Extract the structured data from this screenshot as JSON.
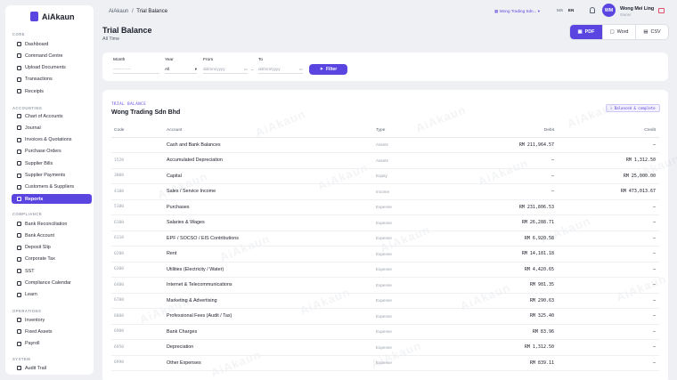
{
  "brand": {
    "name": "AiAkaun"
  },
  "sidebar": {
    "sections": [
      {
        "title": "CORE",
        "items": [
          {
            "label": "Dashboard",
            "icon": "dashboard-icon"
          },
          {
            "label": "Command Centre",
            "icon": "grid-icon"
          },
          {
            "label": "Upload Documents",
            "icon": "upload-icon"
          },
          {
            "label": "Transactions",
            "icon": "transactions-icon"
          },
          {
            "label": "Receipts",
            "icon": "receipt-icon"
          }
        ]
      },
      {
        "title": "ACCOUNTING",
        "items": [
          {
            "label": "Chart of Accounts",
            "icon": "chart-icon"
          },
          {
            "label": "Journal",
            "icon": "journal-icon"
          },
          {
            "label": "Invoices & Quotations",
            "icon": "invoice-icon"
          },
          {
            "label": "Purchase Orders",
            "icon": "cart-icon"
          },
          {
            "label": "Supplier Bills",
            "icon": "bill-icon"
          },
          {
            "label": "Supplier Payments",
            "icon": "payment-icon"
          },
          {
            "label": "Customers & Suppliers",
            "icon": "users-icon"
          },
          {
            "label": "Reports",
            "icon": "report-icon",
            "active": true
          }
        ]
      },
      {
        "title": "COMPLIANCE",
        "items": [
          {
            "label": "Bank Reconciliation",
            "icon": "check-icon"
          },
          {
            "label": "Bank Account",
            "icon": "bank-icon"
          },
          {
            "label": "Deposit Slip",
            "icon": "deposit-icon"
          },
          {
            "label": "Corporate Tax",
            "icon": "tax-icon"
          },
          {
            "label": "SST",
            "icon": "sst-icon"
          },
          {
            "label": "Compliance Calendar",
            "icon": "calendar-icon"
          },
          {
            "label": "Learn",
            "icon": "learn-icon"
          }
        ]
      },
      {
        "title": "OPERATIONS",
        "items": [
          {
            "label": "Inventory",
            "icon": "box-icon"
          },
          {
            "label": "Fixed Assets",
            "icon": "asset-icon"
          },
          {
            "label": "Payroll",
            "icon": "payroll-icon"
          }
        ]
      },
      {
        "title": "SYSTEM",
        "items": [
          {
            "label": "Audit Trail",
            "icon": "audit-icon"
          }
        ]
      }
    ]
  },
  "topbar": {
    "breadcrumb_root": "AiAkaun",
    "breadcrumb_sep": "/",
    "breadcrumb_current": "Trial Balance",
    "company_select": "Wong Trading Sdn...",
    "lang_ms": "MS",
    "lang_en": "EN",
    "avatar_initials": "WM",
    "user_name": "Wong Mei Ling",
    "user_role": "Owner"
  },
  "page": {
    "title": "Trial Balance",
    "subtitle": "All Time"
  },
  "export": {
    "pdf": "PDF",
    "word": "Word",
    "csv": "CSV"
  },
  "filters": {
    "month_label": "Month",
    "month_placeholder": "-------- ----",
    "year_label": "Year",
    "year_value": "All",
    "from_label": "From",
    "from_placeholder": "dd/mm/yyyy",
    "to_label": "To",
    "to_placeholder": "dd/mm/yyyy",
    "dash": "–",
    "filter_button": "Filter"
  },
  "report": {
    "eyebrow": "TRIAL BALANCE",
    "company": "Wong Trading Sdn Bhd",
    "badge": "✓ Balanced & complete",
    "watermark": "AiAkaun",
    "columns": {
      "code": "Code",
      "account": "Account",
      "type": "Type",
      "debit": "Debit",
      "credit": "Credit"
    },
    "rows": [
      {
        "code": "",
        "account": "Cash and Bank Balances",
        "type": "Assets",
        "debit": "RM 211,964.57",
        "credit": "—"
      },
      {
        "code": "1520",
        "account": "Accumulated Depreciation",
        "type": "Assets",
        "debit": "—",
        "credit": "RM 1,312.50"
      },
      {
        "code": "3000",
        "account": "Capital",
        "type": "Equity",
        "debit": "—",
        "credit": "RM 25,000.00"
      },
      {
        "code": "4100",
        "account": "Sales / Service Income",
        "type": "Income",
        "debit": "—",
        "credit": "RM 473,013.67"
      },
      {
        "code": "5100",
        "account": "Purchases",
        "type": "Expense",
        "debit": "RM 231,806.53",
        "credit": "—"
      },
      {
        "code": "6100",
        "account": "Salaries & Wages",
        "type": "Expense",
        "debit": "RM 26,288.71",
        "credit": "—"
      },
      {
        "code": "6110",
        "account": "EPF / SOCSO / EIS Contributions",
        "type": "Expense",
        "debit": "RM 6,920.58",
        "credit": "—"
      },
      {
        "code": "6200",
        "account": "Rent",
        "type": "Expense",
        "debit": "RM 14,181.18",
        "credit": "—"
      },
      {
        "code": "6300",
        "account": "Utilities (Electricity / Water)",
        "type": "Expense",
        "debit": "RM 4,420.65",
        "credit": "—"
      },
      {
        "code": "6400",
        "account": "Internet & Telecommunications",
        "type": "Expense",
        "debit": "RM 981.35",
        "credit": "—"
      },
      {
        "code": "6700",
        "account": "Marketing & Advertising",
        "type": "Expense",
        "debit": "RM 290.63",
        "credit": "—"
      },
      {
        "code": "6800",
        "account": "Professional Fees (Audit / Tax)",
        "type": "Expense",
        "debit": "RM 325.40",
        "credit": "—"
      },
      {
        "code": "6900",
        "account": "Bank Charges",
        "type": "Expense",
        "debit": "RM 83.96",
        "credit": "—"
      },
      {
        "code": "6950",
        "account": "Depreciation",
        "type": "Expense",
        "debit": "RM 1,312.50",
        "credit": "—"
      },
      {
        "code": "6990",
        "account": "Other Expenses",
        "type": "Expense",
        "debit": "RM 839.11",
        "credit": "—"
      }
    ]
  },
  "colors": {
    "accent": "#5b45e0",
    "background": "#eef0f4"
  }
}
